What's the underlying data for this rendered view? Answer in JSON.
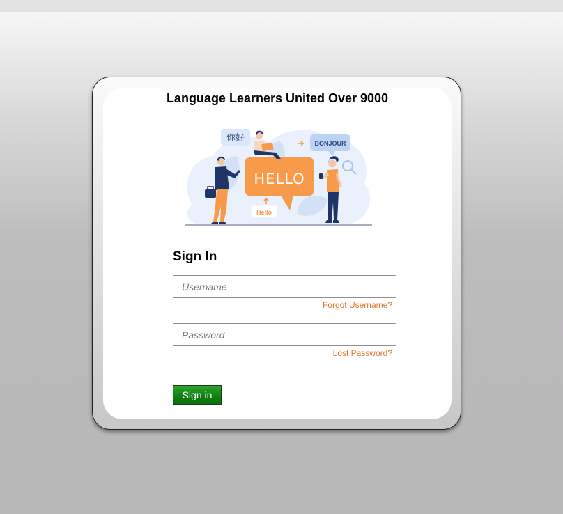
{
  "app": {
    "title": "Language Learners United Over 9000"
  },
  "hero": {
    "image_icon": "language-learners-illustration",
    "bubble_big": "HELLO",
    "bubble_chinese": "你好",
    "bubble_french": "BONJOUR",
    "bubble_small": "Hello"
  },
  "login": {
    "heading": "Sign In",
    "username_placeholder": "Username",
    "username_value": "",
    "forgot_username": "Forgot Username?",
    "password_placeholder": "Password",
    "password_value": "",
    "lost_password": "Lost Password?",
    "submit_label": "Sign in"
  },
  "colors": {
    "accent_link": "#e0742c",
    "button_green": "#138413",
    "hero_orange": "#f79a4a",
    "hero_navy": "#1f3566"
  }
}
